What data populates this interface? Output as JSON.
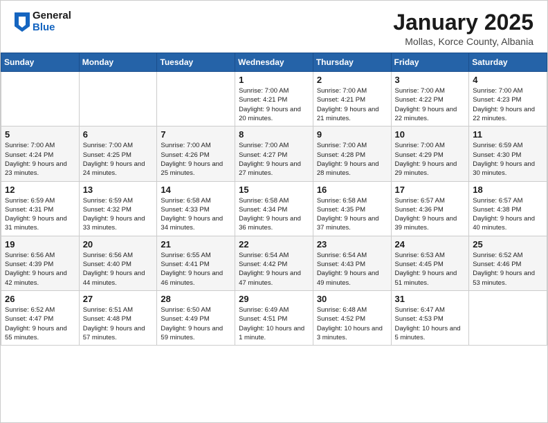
{
  "header": {
    "logo_general": "General",
    "logo_blue": "Blue",
    "title": "January 2025",
    "location": "Mollas, Korce County, Albania"
  },
  "weekdays": [
    "Sunday",
    "Monday",
    "Tuesday",
    "Wednesday",
    "Thursday",
    "Friday",
    "Saturday"
  ],
  "weeks": [
    [
      {
        "day": "",
        "sunrise": "",
        "sunset": "",
        "daylight": ""
      },
      {
        "day": "",
        "sunrise": "",
        "sunset": "",
        "daylight": ""
      },
      {
        "day": "",
        "sunrise": "",
        "sunset": "",
        "daylight": ""
      },
      {
        "day": "1",
        "sunrise": "Sunrise: 7:00 AM",
        "sunset": "Sunset: 4:21 PM",
        "daylight": "Daylight: 9 hours and 20 minutes."
      },
      {
        "day": "2",
        "sunrise": "Sunrise: 7:00 AM",
        "sunset": "Sunset: 4:21 PM",
        "daylight": "Daylight: 9 hours and 21 minutes."
      },
      {
        "day": "3",
        "sunrise": "Sunrise: 7:00 AM",
        "sunset": "Sunset: 4:22 PM",
        "daylight": "Daylight: 9 hours and 22 minutes."
      },
      {
        "day": "4",
        "sunrise": "Sunrise: 7:00 AM",
        "sunset": "Sunset: 4:23 PM",
        "daylight": "Daylight: 9 hours and 22 minutes."
      }
    ],
    [
      {
        "day": "5",
        "sunrise": "Sunrise: 7:00 AM",
        "sunset": "Sunset: 4:24 PM",
        "daylight": "Daylight: 9 hours and 23 minutes."
      },
      {
        "day": "6",
        "sunrise": "Sunrise: 7:00 AM",
        "sunset": "Sunset: 4:25 PM",
        "daylight": "Daylight: 9 hours and 24 minutes."
      },
      {
        "day": "7",
        "sunrise": "Sunrise: 7:00 AM",
        "sunset": "Sunset: 4:26 PM",
        "daylight": "Daylight: 9 hours and 25 minutes."
      },
      {
        "day": "8",
        "sunrise": "Sunrise: 7:00 AM",
        "sunset": "Sunset: 4:27 PM",
        "daylight": "Daylight: 9 hours and 27 minutes."
      },
      {
        "day": "9",
        "sunrise": "Sunrise: 7:00 AM",
        "sunset": "Sunset: 4:28 PM",
        "daylight": "Daylight: 9 hours and 28 minutes."
      },
      {
        "day": "10",
        "sunrise": "Sunrise: 7:00 AM",
        "sunset": "Sunset: 4:29 PM",
        "daylight": "Daylight: 9 hours and 29 minutes."
      },
      {
        "day": "11",
        "sunrise": "Sunrise: 6:59 AM",
        "sunset": "Sunset: 4:30 PM",
        "daylight": "Daylight: 9 hours and 30 minutes."
      }
    ],
    [
      {
        "day": "12",
        "sunrise": "Sunrise: 6:59 AM",
        "sunset": "Sunset: 4:31 PM",
        "daylight": "Daylight: 9 hours and 31 minutes."
      },
      {
        "day": "13",
        "sunrise": "Sunrise: 6:59 AM",
        "sunset": "Sunset: 4:32 PM",
        "daylight": "Daylight: 9 hours and 33 minutes."
      },
      {
        "day": "14",
        "sunrise": "Sunrise: 6:58 AM",
        "sunset": "Sunset: 4:33 PM",
        "daylight": "Daylight: 9 hours and 34 minutes."
      },
      {
        "day": "15",
        "sunrise": "Sunrise: 6:58 AM",
        "sunset": "Sunset: 4:34 PM",
        "daylight": "Daylight: 9 hours and 36 minutes."
      },
      {
        "day": "16",
        "sunrise": "Sunrise: 6:58 AM",
        "sunset": "Sunset: 4:35 PM",
        "daylight": "Daylight: 9 hours and 37 minutes."
      },
      {
        "day": "17",
        "sunrise": "Sunrise: 6:57 AM",
        "sunset": "Sunset: 4:36 PM",
        "daylight": "Daylight: 9 hours and 39 minutes."
      },
      {
        "day": "18",
        "sunrise": "Sunrise: 6:57 AM",
        "sunset": "Sunset: 4:38 PM",
        "daylight": "Daylight: 9 hours and 40 minutes."
      }
    ],
    [
      {
        "day": "19",
        "sunrise": "Sunrise: 6:56 AM",
        "sunset": "Sunset: 4:39 PM",
        "daylight": "Daylight: 9 hours and 42 minutes."
      },
      {
        "day": "20",
        "sunrise": "Sunrise: 6:56 AM",
        "sunset": "Sunset: 4:40 PM",
        "daylight": "Daylight: 9 hours and 44 minutes."
      },
      {
        "day": "21",
        "sunrise": "Sunrise: 6:55 AM",
        "sunset": "Sunset: 4:41 PM",
        "daylight": "Daylight: 9 hours and 46 minutes."
      },
      {
        "day": "22",
        "sunrise": "Sunrise: 6:54 AM",
        "sunset": "Sunset: 4:42 PM",
        "daylight": "Daylight: 9 hours and 47 minutes."
      },
      {
        "day": "23",
        "sunrise": "Sunrise: 6:54 AM",
        "sunset": "Sunset: 4:43 PM",
        "daylight": "Daylight: 9 hours and 49 minutes."
      },
      {
        "day": "24",
        "sunrise": "Sunrise: 6:53 AM",
        "sunset": "Sunset: 4:45 PM",
        "daylight": "Daylight: 9 hours and 51 minutes."
      },
      {
        "day": "25",
        "sunrise": "Sunrise: 6:52 AM",
        "sunset": "Sunset: 4:46 PM",
        "daylight": "Daylight: 9 hours and 53 minutes."
      }
    ],
    [
      {
        "day": "26",
        "sunrise": "Sunrise: 6:52 AM",
        "sunset": "Sunset: 4:47 PM",
        "daylight": "Daylight: 9 hours and 55 minutes."
      },
      {
        "day": "27",
        "sunrise": "Sunrise: 6:51 AM",
        "sunset": "Sunset: 4:48 PM",
        "daylight": "Daylight: 9 hours and 57 minutes."
      },
      {
        "day": "28",
        "sunrise": "Sunrise: 6:50 AM",
        "sunset": "Sunset: 4:49 PM",
        "daylight": "Daylight: 9 hours and 59 minutes."
      },
      {
        "day": "29",
        "sunrise": "Sunrise: 6:49 AM",
        "sunset": "Sunset: 4:51 PM",
        "daylight": "Daylight: 10 hours and 1 minute."
      },
      {
        "day": "30",
        "sunrise": "Sunrise: 6:48 AM",
        "sunset": "Sunset: 4:52 PM",
        "daylight": "Daylight: 10 hours and 3 minutes."
      },
      {
        "day": "31",
        "sunrise": "Sunrise: 6:47 AM",
        "sunset": "Sunset: 4:53 PM",
        "daylight": "Daylight: 10 hours and 5 minutes."
      },
      {
        "day": "",
        "sunrise": "",
        "sunset": "",
        "daylight": ""
      }
    ]
  ]
}
